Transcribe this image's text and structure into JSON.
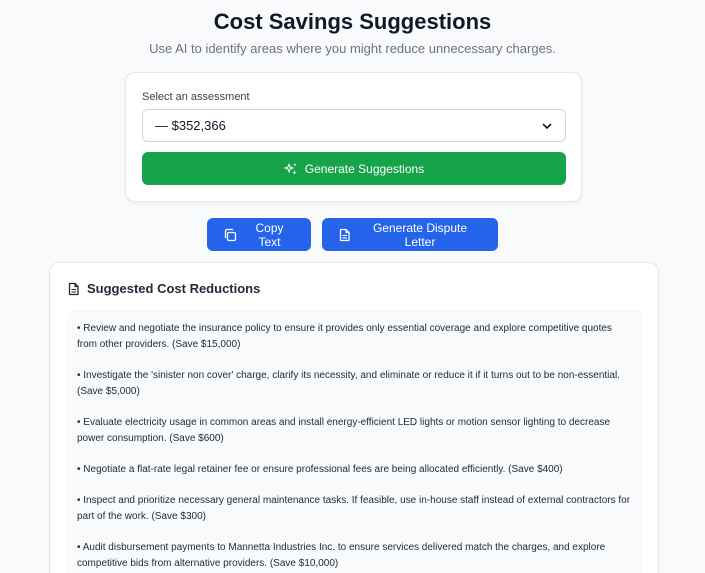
{
  "header": {
    "title": "Cost Savings Suggestions",
    "subtitle": "Use AI to identify areas where you might reduce unnecessary charges."
  },
  "assessment": {
    "label": "Select an assessment",
    "selected": "— $352,366",
    "generate_label": "Generate Suggestions"
  },
  "actions": {
    "copy_label": "Copy Text",
    "dispute_label": "Generate Dispute Letter"
  },
  "results": {
    "title": "Suggested Cost Reductions",
    "items": [
      "• Review and negotiate the insurance policy to ensure it provides only essential coverage and explore competitive quotes from other providers. (Save $15,000)",
      "• Investigate the 'sinister non cover' charge, clarify its necessity, and eliminate or reduce it if it turns out to be non-essential. (Save $5,000)",
      "• Evaluate electricity usage in common areas and install energy-efficient LED lights or motion sensor lighting to decrease power consumption. (Save $600)",
      "• Negotiate a flat-rate legal retainer fee or ensure professional fees are being allocated efficiently. (Save $400)",
      "• Inspect and prioritize necessary general maintenance tasks. If feasible, use in-house staff instead of external contractors for part of the work. (Save $300)",
      "• Audit disbursement payments to Mannetta Industries Inc. to ensure services delivered match the charges, and explore competitive bids from alternative providers. (Save $10,000)"
    ]
  },
  "colors": {
    "green": "#16a34a",
    "blue": "#2563eb"
  }
}
